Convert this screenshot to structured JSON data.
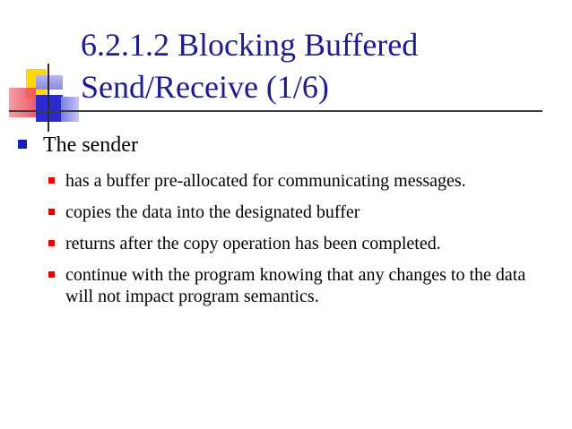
{
  "slide": {
    "title_line1": "6.2.1.2 Blocking Buffered",
    "title_line2": "Send/Receive (1/6)",
    "bullet": "The sender",
    "sub_bullets": [
      "has a buffer pre-allocated for communicating messages.",
      "copies the data into the designated buffer",
      "returns after the copy operation has been completed.",
      "continue with the program knowing that any changes to the data will not impact program semantics."
    ]
  },
  "colors": {
    "title": "#1c1c8c",
    "level1_bullet": "#1c1cb4",
    "level2_bullet": "#e60000",
    "deco_yellow": "#ffd800",
    "deco_blue": "#2a2ad0"
  }
}
